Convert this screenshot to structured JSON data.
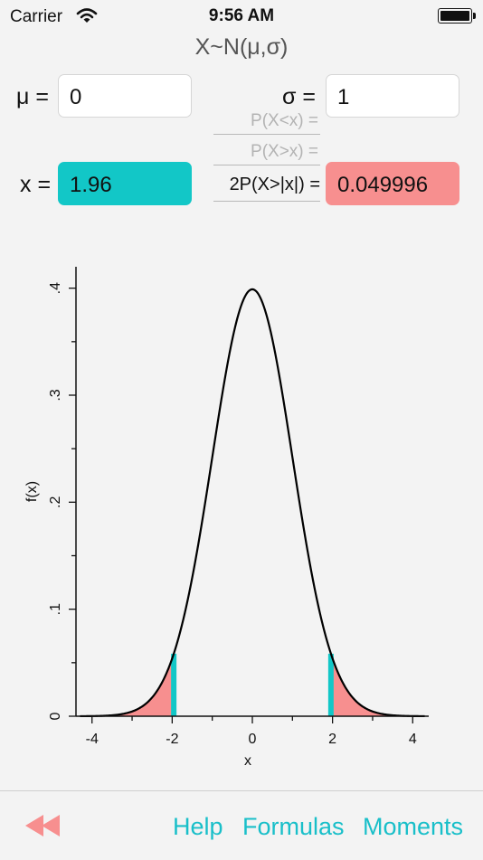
{
  "status": {
    "carrier": "Carrier",
    "time": "9:56 AM"
  },
  "title": "X~N(μ,σ)",
  "inputs": {
    "mu_label": "μ =",
    "mu_value": "0",
    "sigma_label": "σ =",
    "sigma_value": "1",
    "x_label": "x =",
    "x_value": "1.96"
  },
  "probabilities": {
    "less": "P(X<x) =",
    "greater": "P(X>x) =",
    "two_tailed": "2P(X>|x|) =",
    "result": "0.049996"
  },
  "chart_data": {
    "type": "area",
    "xlabel": "x",
    "ylabel": "f(x)",
    "xlim": [
      -4.4,
      4.4
    ],
    "ylim": [
      0,
      0.42
    ],
    "x_ticks": [
      "-4",
      "-2",
      "0",
      "2",
      "4"
    ],
    "x_tick_values": [
      -4,
      -2,
      0,
      2,
      4
    ],
    "y_ticks": [
      "0",
      ".1",
      ".2",
      ".3",
      ".4"
    ],
    "y_tick_values": [
      0,
      0.1,
      0.2,
      0.3,
      0.4
    ],
    "series": [
      {
        "kind": "normal-pdf",
        "mu": 0,
        "sigma": 1,
        "color": "#000000"
      }
    ],
    "shaded_tails": {
      "left_below": -1.96,
      "right_above": 1.96,
      "color": "#f78f8f"
    },
    "markers": {
      "values": [
        -1.96,
        1.96
      ],
      "color": "#12c7c7"
    }
  },
  "tabs": {
    "help": "Help",
    "formulas": "Formulas",
    "moments": "Moments"
  },
  "icons": {
    "back": "double-left-arrow-icon",
    "wifi": "wifi-icon",
    "battery": "battery-icon"
  },
  "colors": {
    "accent": "#19bfc9",
    "teal": "#12c7c7",
    "salmon": "#f78f8f"
  }
}
